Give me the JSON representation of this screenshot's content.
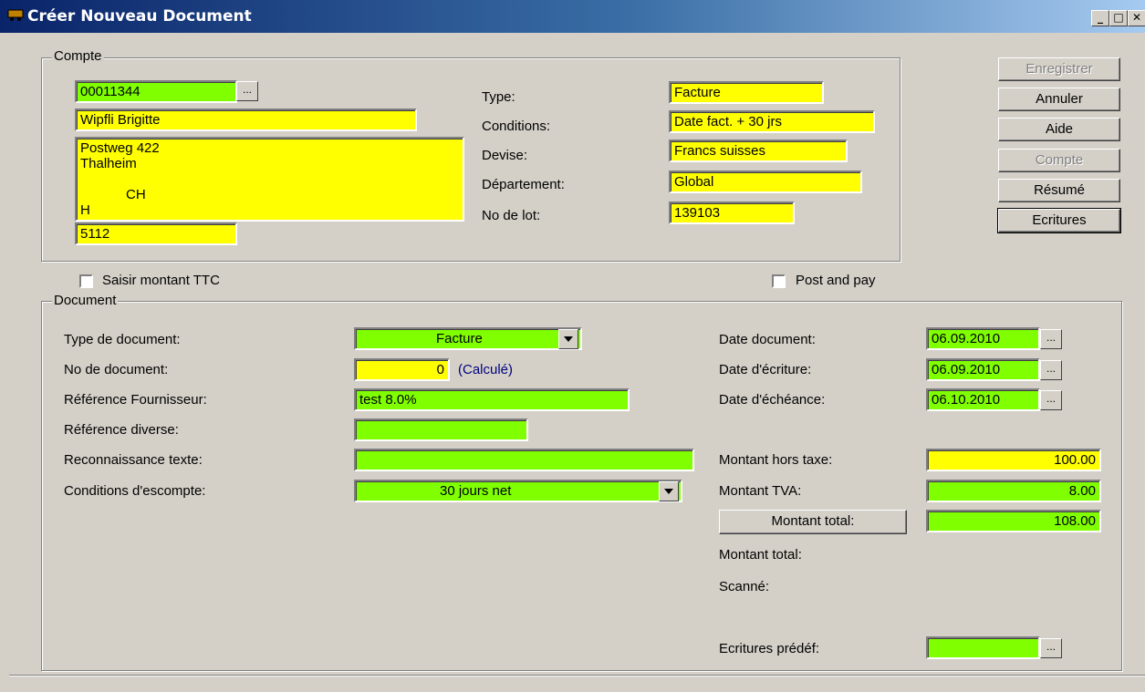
{
  "window": {
    "title": "Créer Nouveau Document"
  },
  "compte": {
    "group_label": "Compte",
    "account_no": "00011344",
    "name": "Wipfli Brigitte",
    "address": "Postweg 422\nThalheim\n\n            CH\nH",
    "postal": "5112",
    "type_label": "Type:",
    "type_value": "Facture",
    "conditions_label": "Conditions:",
    "conditions_value": "Date fact. + 30 jrs",
    "devise_label": "Devise:",
    "devise_value": "Francs suisses",
    "departement_label": "Département:",
    "departement_value": "Global",
    "lot_label": "No de lot:",
    "lot_value": "139103"
  },
  "buttons": {
    "enregistrer": "Enregistrer",
    "annuler": "Annuler",
    "aide": "Aide",
    "compte": "Compte",
    "resume": "Résumé",
    "ecritures": "Ecritures",
    "browse": "..."
  },
  "options": {
    "saisir_ttc": "Saisir montant TTC",
    "post_and_pay": "Post and pay"
  },
  "document": {
    "group_label": "Document",
    "type_doc_label": "Type de document:",
    "type_doc_code": "I",
    "type_doc_value": "Facture",
    "no_doc_label": "No de document:",
    "no_doc_value": "0",
    "no_doc_note": "(Calculé)",
    "ref_fournisseur_label": "Référence Fournisseur:",
    "ref_fournisseur_value": "test 8.0%",
    "ref_diverse_label": "Référence diverse:",
    "ref_diverse_value": "",
    "reconnaissance_label": "Reconnaissance texte:",
    "reconnaissance_value": "",
    "conditions_esc_label": "Conditions d'escompte:",
    "conditions_esc_code": "30",
    "conditions_esc_value": "30 jours net",
    "date_document_label": "Date document:",
    "date_document_value": "06.09.2010",
    "date_ecriture_label": "Date d'écriture:",
    "date_ecriture_value": "06.09.2010",
    "date_echeance_label": "Date d'échéance:",
    "date_echeance_value": "06.10.2010",
    "montant_ht_label": "Montant hors taxe:",
    "montant_ht_value": "100.00",
    "montant_tva_label": "Montant TVA:",
    "montant_tva_value": "8.00",
    "montant_total_button": "Montant total:",
    "montant_total_value": "108.00",
    "montant_total_label": "Montant total:",
    "scanne_label": "Scanné:",
    "ecritures_predef_label": "Ecritures prédéf:",
    "ecritures_predef_value": ""
  }
}
